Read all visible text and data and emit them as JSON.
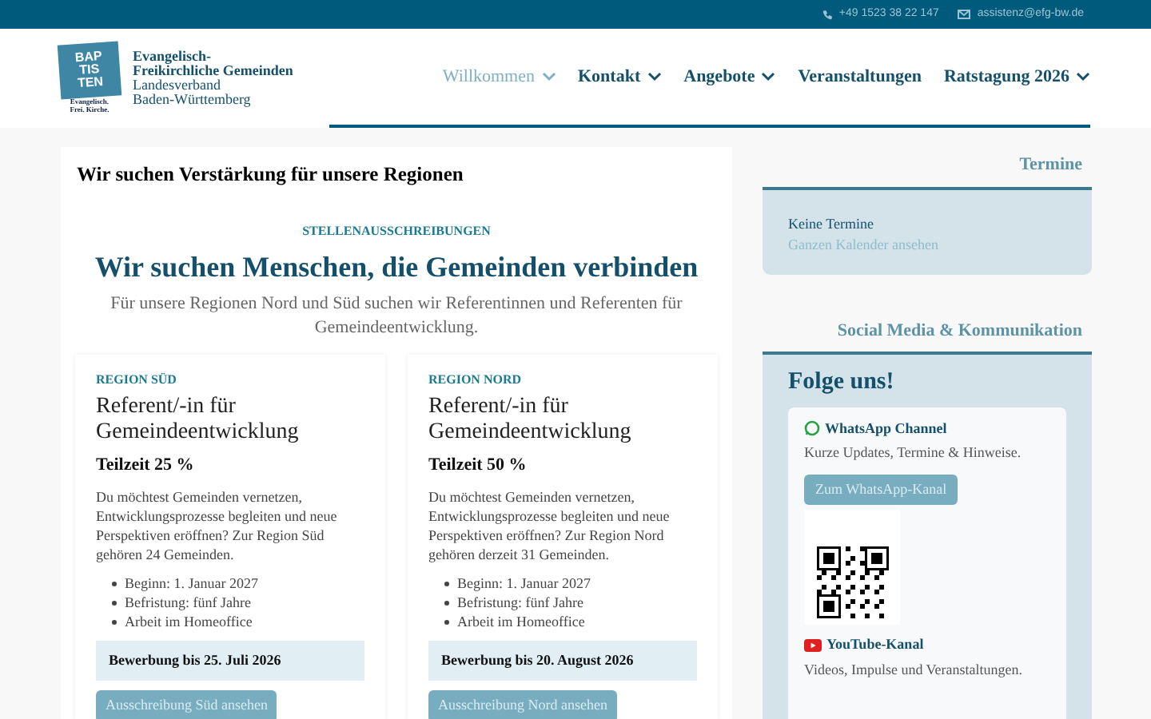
{
  "top_bar": {
    "phone": "+49 1523 38 22 147",
    "email": "assistenz@efg-bw.de"
  },
  "logo": {
    "mark_lines": [
      "BAP",
      "TIS",
      "TEN"
    ],
    "tagline": [
      "Evangelisch.",
      "Frei. Kirche."
    ],
    "name_bold": [
      "Evangelisch-",
      "Freikirchliche Gemeinden"
    ],
    "name": [
      "Landesverband",
      "Baden-Württemberg"
    ]
  },
  "nav": [
    {
      "label": "Willkommen",
      "selected": true,
      "has_menu": true
    },
    {
      "label": "Kontakt",
      "selected": false,
      "has_menu": true
    },
    {
      "label": "Angebote",
      "selected": false,
      "has_menu": true
    },
    {
      "label": "Veranstaltungen",
      "selected": false,
      "has_menu": false
    },
    {
      "label": "Ratstagung 2026",
      "selected": false,
      "has_menu": true
    }
  ],
  "main": {
    "title": "Wir suchen Verstärkung für unsere Regionen",
    "eyebrow": "STELLENAUSSCHREIBUNGEN",
    "heading": "Wir suchen Menschen, die Gemeinden verbinden",
    "intro": "Für unsere Regionen Nord und Süd suchen wir Referentinnen und Referenten für Gemeindeentwicklung.",
    "jobs": [
      {
        "region": "REGION SÜD",
        "title": "Referent/-in für Gemeindeentwicklung",
        "hours": "Teilzeit 25 %",
        "text": "Du möchtest Gemeinden vernetzen, Entwicklungsprozesse begleiten und neue Perspektiven eröffnen? Zur Region Süd gehören 24 Gemeinden.",
        "bullets": [
          "Beginn: 1. Januar 2027",
          "Befristung: fünf Jahre",
          "Arbeit im Homeoffice"
        ],
        "deadline": "Bewerbung bis 25. Juli 2026",
        "button": "Ausschreibung Süd ansehen"
      },
      {
        "region": "REGION NORD",
        "title": "Referent/-in für Gemeindeentwicklung",
        "hours": "Teilzeit 50 %",
        "text": "Du möchtest Gemeinden vernetzen, Entwicklungsprozesse begleiten und neue Perspektiven eröffnen? Zur Region Nord gehören derzeit 31 Gemeinden.",
        "bullets": [
          "Beginn: 1. Januar 2027",
          "Befristung: fünf Jahre",
          "Arbeit im Homeoffice"
        ],
        "deadline": "Bewerbung bis 20. August 2026",
        "button": "Ausschreibung Nord ansehen"
      }
    ]
  },
  "termine": {
    "title": "Termine",
    "empty": "Keine Termine",
    "link": "Ganzen Kalender ansehen"
  },
  "social": {
    "title": "Social Media & Kommunikation",
    "heading": "Folge uns!",
    "channels": [
      {
        "kind": "whatsapp",
        "name": "WhatsApp Channel",
        "text": "Kurze Updates, Termine & Hinweise.",
        "button": "Zum WhatsApp-Kanal",
        "qr": true
      },
      {
        "kind": "youtube",
        "name": "YouTube-Kanal",
        "text": "Videos, Impulse und Veranstaltungen.",
        "qr": false
      }
    ]
  }
}
